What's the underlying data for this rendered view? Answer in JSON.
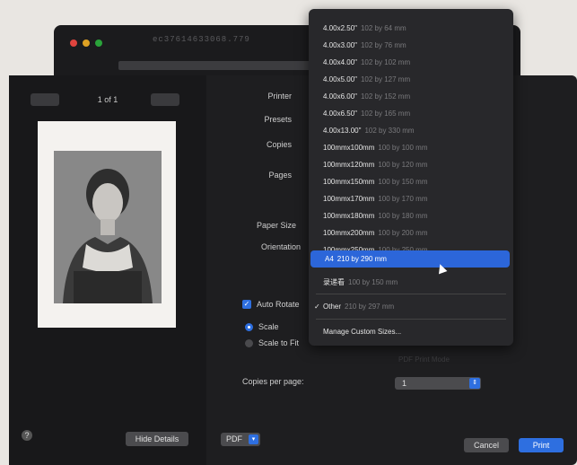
{
  "background_window": {
    "title": "ec37614633068.779"
  },
  "preview": {
    "page_count": "1 of 1"
  },
  "labels": {
    "printer": "Printer",
    "presets": "Presets",
    "copies": "Copies",
    "pages": "Pages",
    "paper_size": "Paper Size",
    "orientation": "Orientation",
    "copies_per_page": "Copies per page:"
  },
  "options": {
    "auto_rotate": "Auto Rotate",
    "scale": "Scale",
    "scale_to_fit": "Scale to Fit"
  },
  "copies_per_page_value": "1",
  "paper_menu": {
    "items": [
      {
        "name": "4.00x2.50\"",
        "dims": "102 by 64 mm"
      },
      {
        "name": "4.00x3.00\"",
        "dims": "102 by 76 mm"
      },
      {
        "name": "4.00x4.00\"",
        "dims": "102 by 102 mm"
      },
      {
        "name": "4.00x5.00\"",
        "dims": "102 by 127 mm"
      },
      {
        "name": "4.00x6.00\"",
        "dims": "102 by 152 mm"
      },
      {
        "name": "4.00x6.50\"",
        "dims": "102 by 165 mm"
      },
      {
        "name": "4.00x13.00\"",
        "dims": "102 by 330 mm"
      },
      {
        "name": "100mmx100mm",
        "dims": "100 by 100 mm"
      },
      {
        "name": "100mmx120mm",
        "dims": "100 by 120 mm"
      },
      {
        "name": "100mmx150mm",
        "dims": "100 by 150 mm"
      },
      {
        "name": "100mmx170mm",
        "dims": "100 by 170 mm"
      },
      {
        "name": "100mmx180mm",
        "dims": "100 by 180 mm"
      },
      {
        "name": "100mmx200mm",
        "dims": "100 by 200 mm"
      },
      {
        "name": "100mmx250mm",
        "dims": "100 by 250 mm"
      },
      {
        "name": "A4",
        "dims": "210 by 290 mm"
      },
      {
        "name": "录递看",
        "dims": "100 by 150 mm"
      }
    ],
    "other": {
      "name": "Other",
      "dims": "210 by 297 mm"
    },
    "manage": "Manage Custom Sizes..."
  },
  "buttons": {
    "help": "?",
    "hide_details": "Hide Details",
    "pdf": "PDF",
    "cancel": "Cancel",
    "print": "Print"
  },
  "colors": {
    "accent": "#2e6fe0",
    "dialog_bg": "#1e1e20",
    "menu_bg": "#28282b"
  }
}
